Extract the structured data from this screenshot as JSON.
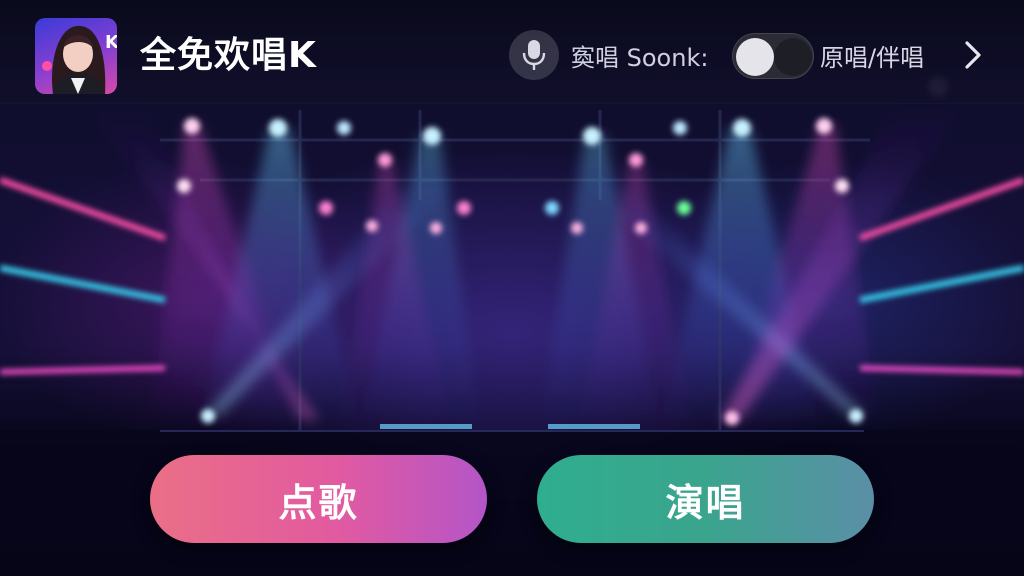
{
  "app": {
    "title": "全免欢唱K",
    "icon": "app-avatar-icon"
  },
  "header": {
    "mic_icon": "microphone-icon",
    "mode_label": "寏唱 Soonk:",
    "toggle_on": true,
    "toggle_label": "原唱/伴唱",
    "more_icon": "chevron-right-icon"
  },
  "actions": {
    "select_song_label": "点歌",
    "sing_label": "演唱"
  },
  "colors": {
    "select_song_start": "#ea6f86",
    "select_song_end": "#b455c8",
    "sing_start": "#2fae8f",
    "sing_end": "#5b8fa7",
    "toggle_knob": "#e4e4ea"
  }
}
